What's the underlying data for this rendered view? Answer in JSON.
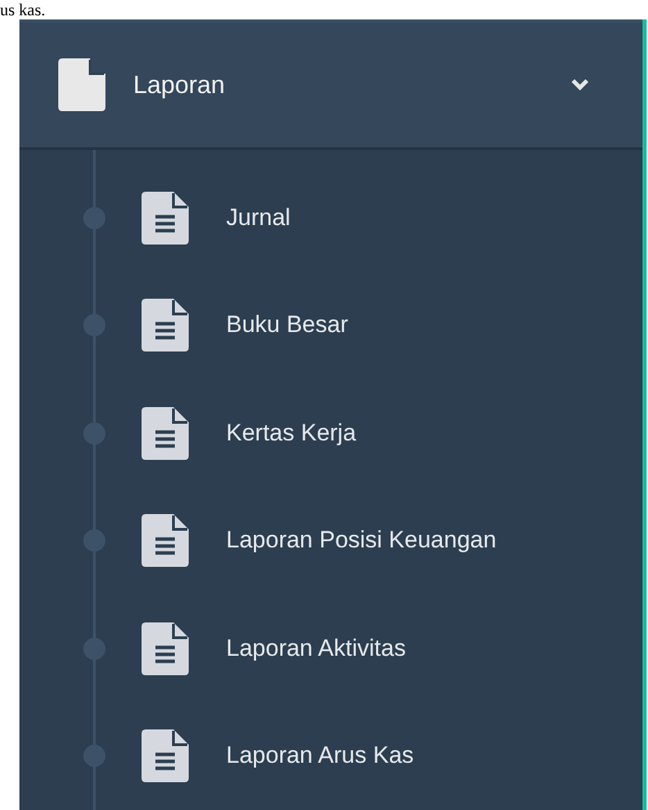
{
  "top_text": "us kas.",
  "menu": {
    "title": "Laporan",
    "expanded": true,
    "items": [
      {
        "label": "Jurnal"
      },
      {
        "label": "Buku Besar"
      },
      {
        "label": "Kertas Kerja"
      },
      {
        "label": "Laporan Posisi Keuangan"
      },
      {
        "label": "Laporan Aktivitas"
      },
      {
        "label": "Laporan Arus Kas"
      }
    ]
  }
}
